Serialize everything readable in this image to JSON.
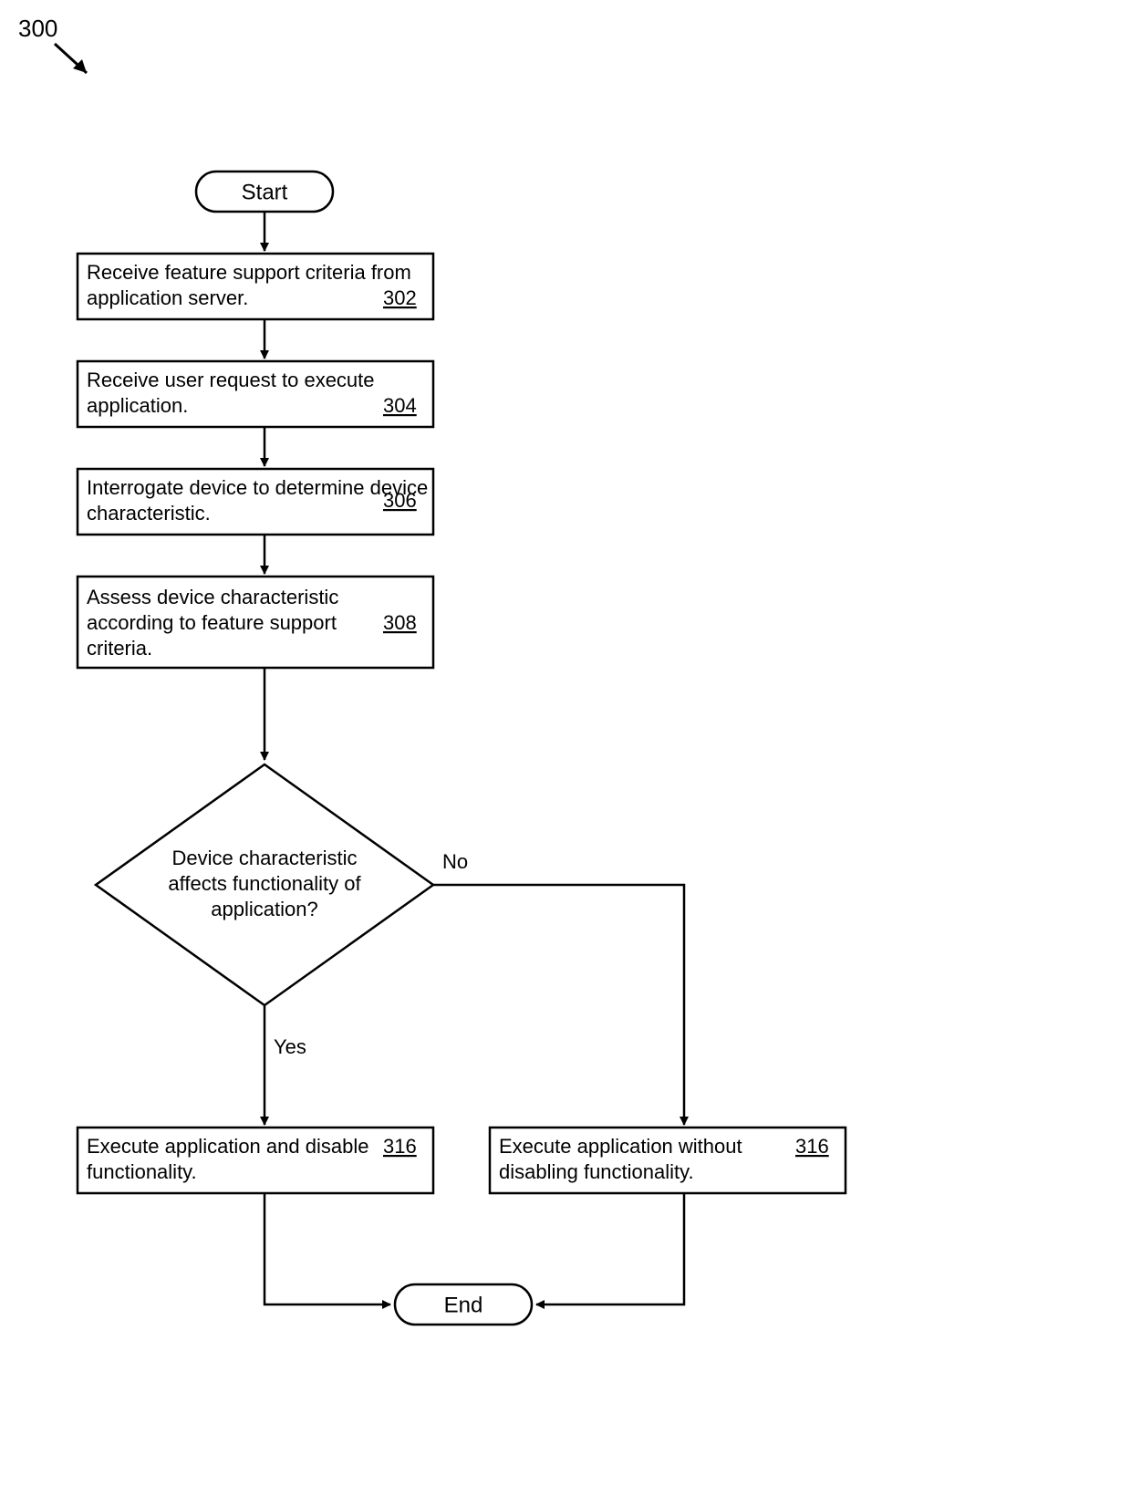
{
  "figure_ref": "300",
  "terminals": {
    "start": "Start",
    "end": "End"
  },
  "steps": {
    "s302": {
      "text": "Receive feature support criteria from application server.",
      "ref": "302"
    },
    "s304": {
      "text": "Receive user request to execute application.",
      "ref": "304"
    },
    "s306": {
      "text": "Interrogate device to determine device characteristic.",
      "ref": "306"
    },
    "s308": {
      "text": "Assess device characteristic according to feature support criteria.",
      "ref": "308"
    },
    "s316a": {
      "text": "Execute application and disable functionality.",
      "ref": "316"
    },
    "s316b": {
      "text": "Execute application without disabling functionality.",
      "ref": "316"
    }
  },
  "decision": {
    "line1": "Device characteristic",
    "line2": "affects functionality of",
    "line3": "application?"
  },
  "branches": {
    "yes": "Yes",
    "no": "No"
  }
}
